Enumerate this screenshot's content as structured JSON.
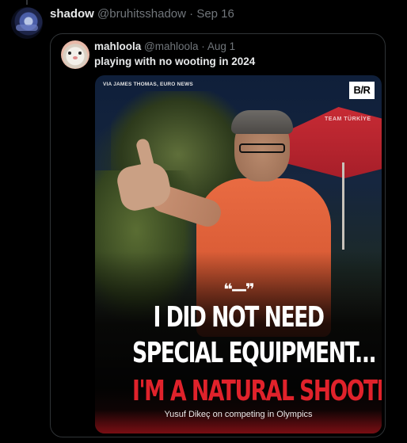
{
  "tweet": {
    "display_name": "shadow",
    "handle": "@bruhitsshadow",
    "separator": "·",
    "date": "Sep 16",
    "avatar_icon": "avatar-icon"
  },
  "quote": {
    "display_name": "mahloola",
    "handle": "@mahloola",
    "separator": "·",
    "date": "Aug 1",
    "text": "playing with no wooting in 2024",
    "avatar_icon": "avatar-icon"
  },
  "media": {
    "credit": "VIA JAMES THOMAS, EURO NEWS",
    "logo": "B/R",
    "umbrella_text": "TEAM TÜRKİYE",
    "quote_glyph": "❝—❞",
    "headline_line1": "I DID NOT NEED",
    "headline_line2": "SPECIAL EQUIPMENT...",
    "headline_line3": "I'M A NATURAL SHOOTER",
    "caption": "Yusuf Dikeç on competing in Olympics",
    "accent_color": "#e0222b",
    "shirt_color": "#e96b42"
  },
  "colors": {
    "background": "#000000",
    "text_primary": "#e7e9ea",
    "text_muted": "#71767b",
    "border": "#2f3336"
  }
}
